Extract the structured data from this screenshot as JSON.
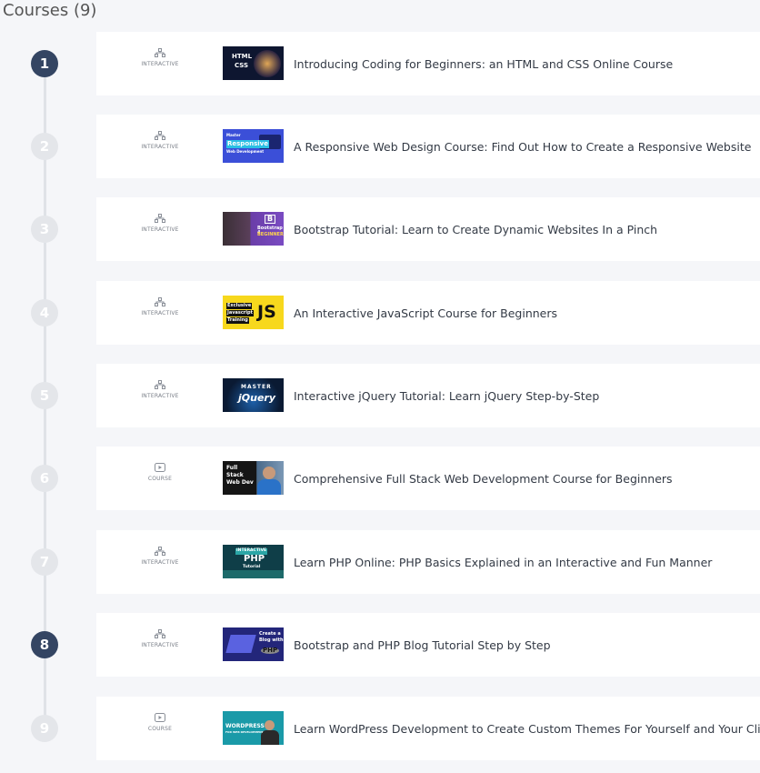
{
  "page": {
    "heading": "Courses (9)"
  },
  "colors": {
    "active_step": "#344563",
    "inactive_step": "#e4e6ea",
    "row_bg": "#ffffff",
    "page_bg": "#f5f6f9"
  },
  "courses": [
    {
      "number": "1",
      "active": true,
      "type": "INTERACTIVE",
      "type_icon": "interactive-icon",
      "title": "Introducing Coding for Beginners: an HTML and CSS Online Course",
      "thumb_text": [
        "HTML",
        "CSS"
      ]
    },
    {
      "number": "2",
      "active": false,
      "type": "INTERACTIVE",
      "type_icon": "interactive-icon",
      "title": "A Responsive Web Design Course: Find Out How to Create a Responsive Website",
      "thumb_text": [
        "Master",
        "Responsive",
        "Web Development"
      ]
    },
    {
      "number": "3",
      "active": false,
      "type": "INTERACTIVE",
      "type_icon": "interactive-icon",
      "title": "Bootstrap Tutorial: Learn to Create Dynamic Websites In a Pinch",
      "thumb_text": [
        "B",
        "Bootstrap 4",
        "BEGINNER"
      ]
    },
    {
      "number": "4",
      "active": false,
      "type": "INTERACTIVE",
      "type_icon": "interactive-icon",
      "title": "An Interactive JavaScript Course for Beginners",
      "thumb_text": [
        "Exclusive",
        "Javascript",
        "Training",
        "JS"
      ]
    },
    {
      "number": "5",
      "active": false,
      "type": "INTERACTIVE",
      "type_icon": "interactive-icon",
      "title": "Interactive jQuery Tutorial: Learn jQuery Step-by-Step",
      "thumb_text": [
        "MASTER",
        "jQuery"
      ]
    },
    {
      "number": "6",
      "active": false,
      "type": "COURSE",
      "type_icon": "video-play-icon",
      "title": "Comprehensive Full Stack Web Development Course for Beginners",
      "thumb_text": [
        "Full",
        "Stack",
        "Web Dev"
      ]
    },
    {
      "number": "7",
      "active": false,
      "type": "INTERACTIVE",
      "type_icon": "interactive-icon",
      "title": "Learn PHP Online: PHP Basics Explained in an Interactive and Fun Manner",
      "thumb_text": [
        "INTERACTIVE",
        "PHP",
        "Tutorial"
      ]
    },
    {
      "number": "8",
      "active": true,
      "type": "INTERACTIVE",
      "type_icon": "interactive-icon",
      "title": "Bootstrap and PHP Blog Tutorial Step by Step",
      "thumb_text": [
        "Create a",
        "Blog with",
        "PHP"
      ]
    },
    {
      "number": "9",
      "active": false,
      "type": "COURSE",
      "type_icon": "video-play-icon",
      "title": "Learn WordPress Development to Create Custom Themes For Yourself and Your Clients!",
      "thumb_text": [
        "WORDPRESS",
        "FOR WEB DEVELOPMENT"
      ]
    }
  ]
}
